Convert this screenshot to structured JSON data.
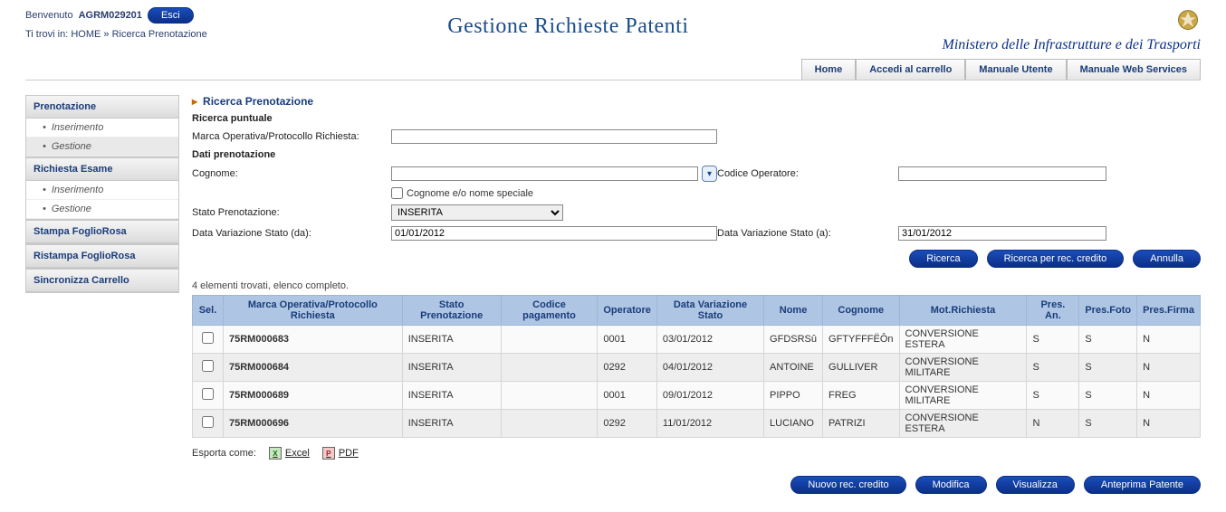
{
  "header": {
    "welcome_label": "Benvenuto",
    "user": "AGRM029201",
    "logout_label": "Esci",
    "breadcrumb_prefix": "Ti trovi in:",
    "breadcrumb_home": "HOME",
    "breadcrumb_sep": "»",
    "breadcrumb_page": "Ricerca Prenotazione",
    "title": "Gestione Richieste Patenti",
    "ministry": "Ministero delle Infrastrutture e dei Trasporti"
  },
  "tabs": [
    "Home",
    "Accedi al carrello",
    "Manuale Utente",
    "Manuale Web Services"
  ],
  "sidebar": [
    {
      "title": "Prenotazione",
      "items": [
        "Inserimento",
        "Gestione"
      ],
      "active": 1
    },
    {
      "title": "Richiesta Esame",
      "items": [
        "Inserimento",
        "Gestione"
      ]
    },
    {
      "title": "Stampa FoglioRosa",
      "items": []
    },
    {
      "title": "Ristampa FoglioRosa",
      "items": []
    },
    {
      "title": "Sincronizza Carrello",
      "items": []
    }
  ],
  "section_title": "Ricerca Prenotazione",
  "subhead1": "Ricerca puntuale",
  "subhead2": "Dati prenotazione",
  "form": {
    "protocol_label": "Marca Operativa/Protocollo Richiesta:",
    "protocol_value": "",
    "cognome_label": "Cognome:",
    "cognome_value": "",
    "cognome_special_label": "Cognome e/o nome speciale",
    "codice_operatore_label": "Codice Operatore:",
    "codice_operatore_value": "",
    "stato_label": "Stato Prenotazione:",
    "stato_value": "INSERITA",
    "dvs_da_label": "Data Variazione Stato (da):",
    "dvs_da_value": "01/01/2012",
    "dvs_a_label": "Data Variazione Stato (a):",
    "dvs_a_value": "31/01/2012"
  },
  "buttons": {
    "ricerca": "Ricerca",
    "ricerca_rec": "Ricerca per rec. credito",
    "annulla": "Annulla",
    "nuovo": "Nuovo rec. credito",
    "modifica": "Modifica",
    "visualizza": "Visualizza",
    "anteprima": "Anteprima Patente"
  },
  "results_caption": "4 elementi trovati, elenco completo.",
  "columns": [
    "Sel.",
    "Marca Operativa/Protocollo Richiesta",
    "Stato Prenotazione",
    "Codice pagamento",
    "Operatore",
    "Data Variazione Stato",
    "Nome",
    "Cognome",
    "Mot.Richiesta",
    "Pres. An.",
    "Pres.Foto",
    "Pres.Firma"
  ],
  "rows": [
    {
      "protocollo": "75RM000683",
      "stato": "INSERITA",
      "codice_pag": "",
      "operatore": "0001",
      "dvs": "03/01/2012",
      "nome": "GFDSRSû",
      "cognome": "GFTYFFFËÔn",
      "mot": "CONVERSIONE ESTERA",
      "pres_an": "S",
      "pres_foto": "S",
      "pres_firma": "N"
    },
    {
      "protocollo": "75RM000684",
      "stato": "INSERITA",
      "codice_pag": "",
      "operatore": "0292",
      "dvs": "04/01/2012",
      "nome": "ANTOINE",
      "cognome": "GULLIVER",
      "mot": "CONVERSIONE MILITARE",
      "pres_an": "S",
      "pres_foto": "S",
      "pres_firma": "N"
    },
    {
      "protocollo": "75RM000689",
      "stato": "INSERITA",
      "codice_pag": "",
      "operatore": "0001",
      "dvs": "09/01/2012",
      "nome": "PIPPO",
      "cognome": "FREG",
      "mot": "CONVERSIONE MILITARE",
      "pres_an": "S",
      "pres_foto": "S",
      "pres_firma": "N"
    },
    {
      "protocollo": "75RM000696",
      "stato": "INSERITA",
      "codice_pag": "",
      "operatore": "0292",
      "dvs": "11/01/2012",
      "nome": "LUCIANO",
      "cognome": "PATRIZI",
      "mot": "CONVERSIONE ESTERA",
      "pres_an": "N",
      "pres_foto": "S",
      "pres_firma": "N"
    }
  ],
  "export": {
    "label": "Esporta come:",
    "excel": "Excel",
    "pdf": "PDF"
  }
}
